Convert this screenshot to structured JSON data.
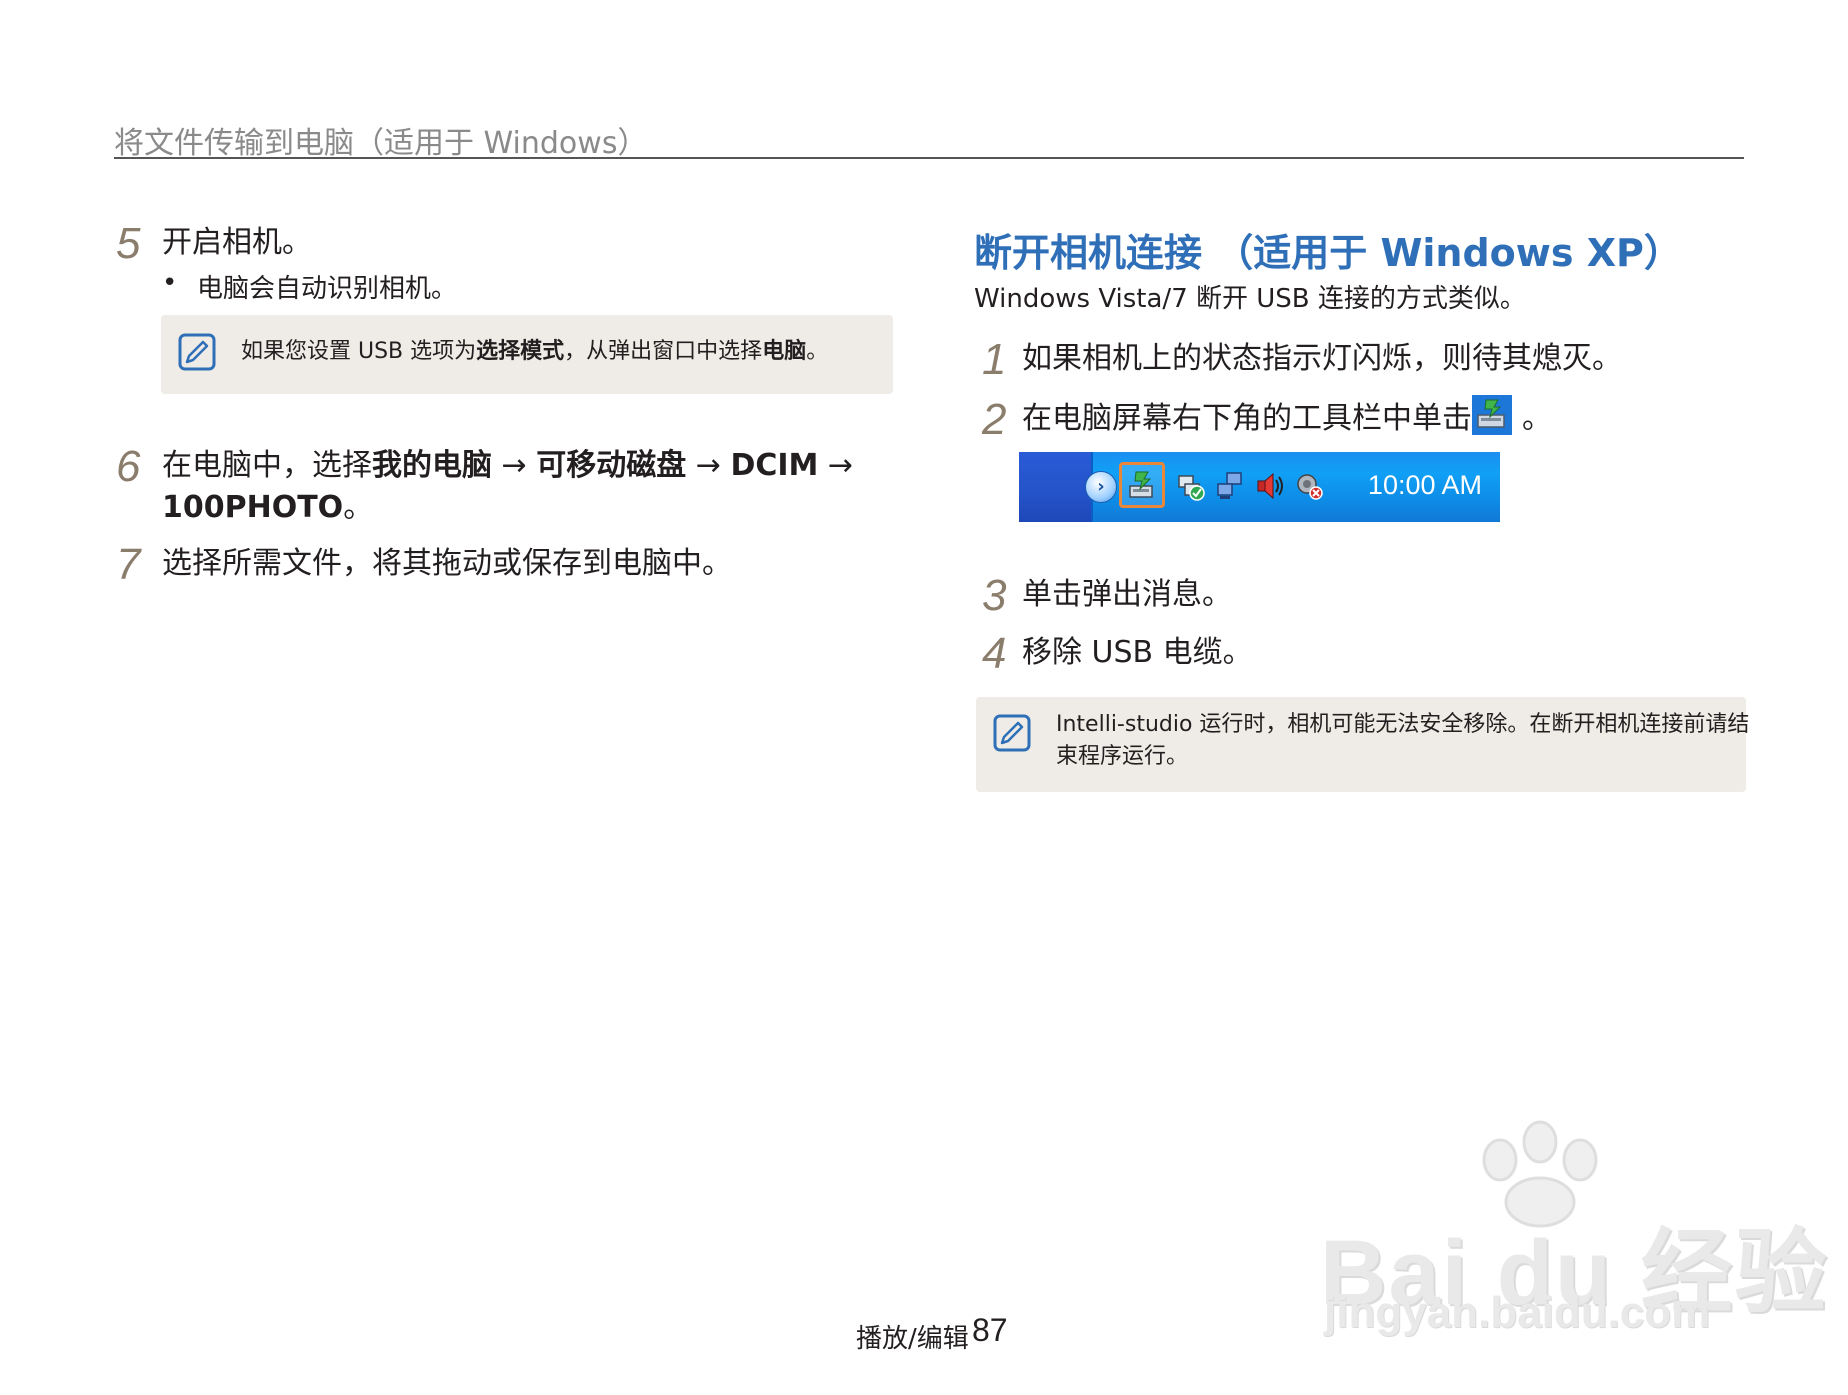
{
  "header": {
    "title": "将文件传输到电脑（适用于 Windows）"
  },
  "left": {
    "step5": {
      "number": "5",
      "text": "开启相机。",
      "bullet": "电脑会自动识别相机。"
    },
    "note1": {
      "pre": "如果您设置 USB 选项为",
      "bold1": "选择模式",
      "mid": "，从弹出窗口中选择",
      "bold2": "电脑",
      "post": "。"
    },
    "step6": {
      "number": "6",
      "pre": "在电脑中，选择",
      "bold1": "我的电脑",
      "arrow1": " → ",
      "bold2": "可移动磁盘",
      "arrow2": " → ",
      "bold3": "DCIM",
      "arrow3": " →",
      "bold4": "100PHOTO",
      "post": "。"
    },
    "step7": {
      "number": "7",
      "text": "选择所需文件，将其拖动或保存到电脑中。"
    }
  },
  "right": {
    "heading": "断开相机连接 （适用于 Windows XP）",
    "subtitle": "Windows Vista/7 断开 USB 连接的方式类似。",
    "step1": {
      "number": "1",
      "text": "如果相机上的状态指示灯闪烁，则待其熄灭。"
    },
    "step2": {
      "number": "2",
      "text": "在电脑屏幕右下角的工具栏中单击",
      "post": "。"
    },
    "taskbar": {
      "clock": "10:00 AM",
      "icons": [
        "usb-safely-remove-icon",
        "network-check-icon",
        "network-computers-icon",
        "volume-icon",
        "security-alert-icon"
      ]
    },
    "step3": {
      "number": "3",
      "text": "单击弹出消息。"
    },
    "step4": {
      "number": "4",
      "text": "移除 USB 电缆。"
    },
    "note2": {
      "line1": "Intelli-studio 运行时，相机可能无法安全移除。在断开相机连接前请结",
      "line2": "束程序运行。"
    }
  },
  "footer": {
    "section": "播放/编辑",
    "page": "87"
  },
  "watermark": {
    "main": "Bai du 经验",
    "url": "jingyan.baidu.com"
  },
  "colors": {
    "heading_blue": "#2f6fb8",
    "step_number": "#8b7d6b",
    "note_bg": "#efebe6",
    "header_gray": "#8a8a8a"
  }
}
